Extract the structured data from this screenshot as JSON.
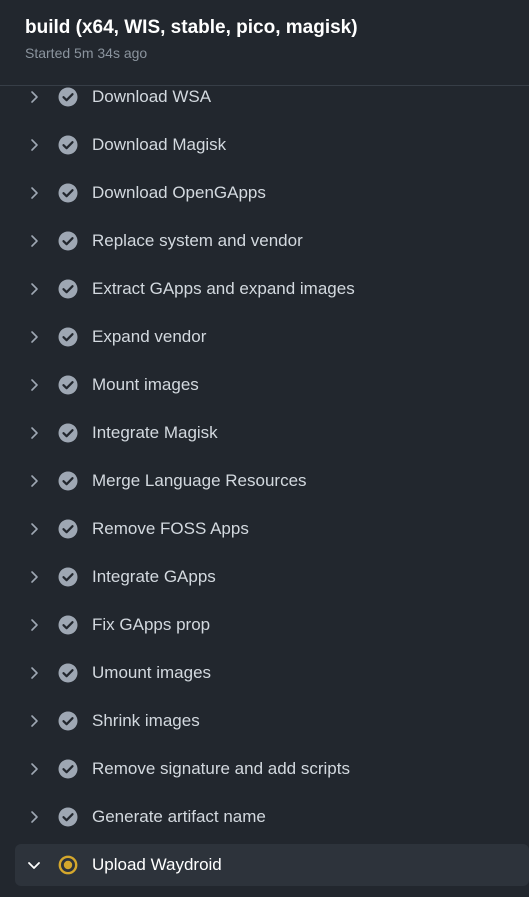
{
  "job": {
    "title": "build (x64, WIS, stable, pico, magisk)",
    "started": "Started 5m 34s ago"
  },
  "colors": {
    "success_icon": "#9ea7b3",
    "in_progress_icon": "#d4a72c"
  },
  "steps": [
    {
      "label": "Download WSA",
      "status": "success",
      "icon": "check-circle-icon"
    },
    {
      "label": "Download Magisk",
      "status": "success",
      "icon": "check-circle-icon"
    },
    {
      "label": "Download OpenGApps",
      "status": "success",
      "icon": "check-circle-icon"
    },
    {
      "label": "Replace system and vendor",
      "status": "success",
      "icon": "check-circle-icon"
    },
    {
      "label": "Extract GApps and expand images",
      "status": "success",
      "icon": "check-circle-icon"
    },
    {
      "label": "Expand vendor",
      "status": "success",
      "icon": "check-circle-icon"
    },
    {
      "label": "Mount images",
      "status": "success",
      "icon": "check-circle-icon"
    },
    {
      "label": "Integrate Magisk",
      "status": "success",
      "icon": "check-circle-icon"
    },
    {
      "label": "Merge Language Resources",
      "status": "success",
      "icon": "check-circle-icon"
    },
    {
      "label": "Remove FOSS Apps",
      "status": "success",
      "icon": "check-circle-icon"
    },
    {
      "label": "Integrate GApps",
      "status": "success",
      "icon": "check-circle-icon"
    },
    {
      "label": "Fix GApps prop",
      "status": "success",
      "icon": "check-circle-icon"
    },
    {
      "label": "Umount images",
      "status": "success",
      "icon": "check-circle-icon"
    },
    {
      "label": "Shrink images",
      "status": "success",
      "icon": "check-circle-icon"
    },
    {
      "label": "Remove signature and add scripts",
      "status": "success",
      "icon": "check-circle-icon"
    },
    {
      "label": "Generate artifact name",
      "status": "success",
      "icon": "check-circle-icon"
    },
    {
      "label": "Upload Waydroid",
      "status": "in_progress",
      "icon": "in-progress-icon"
    }
  ]
}
